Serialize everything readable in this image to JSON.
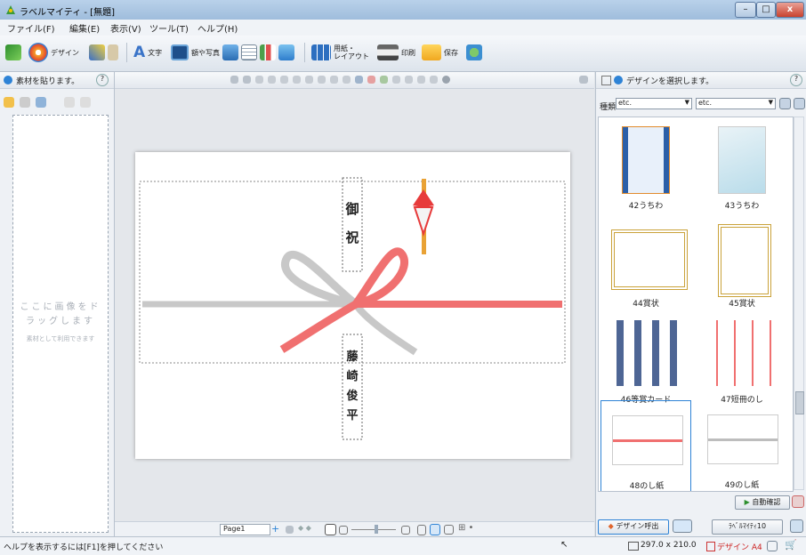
{
  "window": {
    "title": "ラベルマイティ - [無題]",
    "minimize": "–",
    "maximize": "□",
    "close": "x"
  },
  "menu": [
    "ファイル(F)",
    "編集(E)",
    "表示(V)",
    "ツール(T)",
    "ヘルプ(H)"
  ],
  "toolbar": {
    "design": "デザイン",
    "text": "文字",
    "frame_photo": "額や写真",
    "paper_layout_1": "用紙・",
    "paper_layout_2": "レイアウト",
    "print": "印刷",
    "save": "保存"
  },
  "left_panel": {
    "header": "素材を貼ります。",
    "help": "?",
    "drop_main": "ここに画像をドラッグします",
    "drop_sub": "素材として利用できます"
  },
  "canvas": {
    "gift_top_1": "御",
    "gift_top_2": "祝",
    "name_1": "藤",
    "name_2": "崎",
    "name_3": "俊",
    "name_4": "平",
    "page_label": "Page1"
  },
  "right_panel": {
    "header": "デザインを選択します。",
    "help": "?",
    "type_label": "種類",
    "filter1": "etc.",
    "filter2": "etc.",
    "items": [
      {
        "label": "42うちわ"
      },
      {
        "label": "43うちわ"
      },
      {
        "label": "44賞状"
      },
      {
        "label": "45賞状"
      },
      {
        "label": "46等賞カード"
      },
      {
        "label": "47短冊のし"
      },
      {
        "label": "48のし紙"
      },
      {
        "label": "49のし紙"
      }
    ],
    "auto_confirm": "自動確認",
    "design_call": "デザイン呼出",
    "version_label": "ﾗﾍﾞﾙﾏｲﾃｨ10"
  },
  "status": {
    "help_text": "ヘルプを表示するには[F1]を押してください",
    "paper_size": "297.0 x 210.0",
    "design_paper": "デザイン A4"
  },
  "colors": {
    "accent": "#2e83d6",
    "mizuhiki_red": "#f06a6a",
    "mizuhiki_gray": "#c8c8c8"
  }
}
